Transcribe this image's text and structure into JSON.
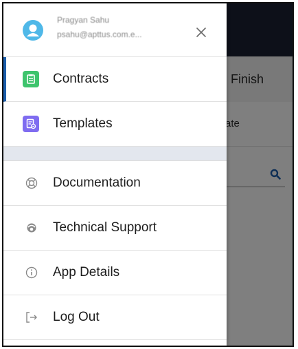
{
  "background": {
    "step_label": "Finish",
    "row_label": "ate"
  },
  "profile": {
    "name": "Pragyan Sahu",
    "email": "psahu@apttus.com.e..."
  },
  "nav": {
    "apps": [
      {
        "label": "Contracts",
        "icon": "contracts-icon",
        "color": "#3ec46d",
        "active": true
      },
      {
        "label": "Templates",
        "icon": "templates-icon",
        "color": "#7f6cf0",
        "active": false
      }
    ],
    "utilities": [
      {
        "label": "Documentation",
        "icon": "lifebuoy-icon"
      },
      {
        "label": "Technical Support",
        "icon": "support-icon"
      },
      {
        "label": "App Details",
        "icon": "info-icon"
      },
      {
        "label": "Log Out",
        "icon": "logout-icon"
      }
    ]
  },
  "colors": {
    "accent": "#1b5dab",
    "header_bg": "#1a2132",
    "section_bg": "#e3e7ee"
  }
}
